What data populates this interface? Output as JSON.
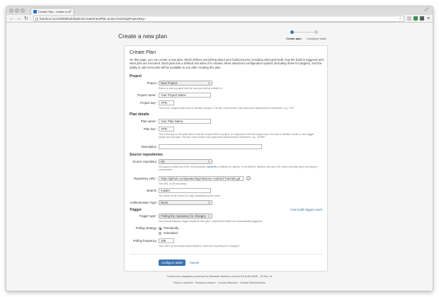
{
  "browser": {
    "tab_title": "Create Plan - Create a ne",
    "url": "bamboo.local:8085/build/admin/create/newPlan.action?existingProjectKey="
  },
  "header": {
    "title": "Create a new plan"
  },
  "wizard": {
    "steps": [
      "Create plan",
      "Configure tasks"
    ]
  },
  "form": {
    "heading": "Create Plan",
    "intro": "On this page, you can create a new plan, which defines everything about your build process, including what gets built, how the build is triggered and what jobs are executed. Each plan has a Default Job when it is created. More advanced configuration options (including those for plugins), and the ability to add more jobs will be available to you after creating this plan.",
    "project_section": "Project",
    "project_label": "Project",
    "project_value": "New Project",
    "project_help": "Select or add a project that the new plan will be created in",
    "project_name_label": "Project name",
    "project_name_value": "Your Project Name",
    "project_key_label": "Project key",
    "project_key_value": "YPN",
    "project_key_help": "This is the unique project key to identify a project. The key must contain only uppercase alphanumeric characters. e.g. \"FIX\".",
    "plan_section": "Plan details",
    "plan_name_label": "Plan name",
    "plan_name_value": "Your Plan Name",
    "plan_key_label": "Plan key",
    "plan_key_value": "YPN",
    "plan_key_help": "This is the key for the plan which must be unique within a project. In conjunction with the project key, it is used to identify a build in urls, trigger scripts and api calls. The key must contain only uppercase alphanumeric characters. e.g. \"CORE\".",
    "description_label": "Description",
    "source_section": "Source repositories",
    "source_repo_label": "Source repository",
    "source_repo_value": "Git",
    "source_repo_help_a": "Git support works best if the Git executable",
    "source_repo_help_link": "capability",
    "source_repo_help_b": "is defined for agents. If not defined, Bamboo will use JGit, which currently does not support submodules.",
    "repo_url_label": "Repository URL",
    "repo_url_value": "https://github.com/javatechig/Advance-Android-Tutorials.git",
    "repo_url_help": "The URL of Git repository",
    "branch_label": "Branch",
    "branch_value": "master",
    "branch_help": "The name of the branch (or tag) containing source code.",
    "auth_label": "Authentication Type",
    "auth_value": "None",
    "trigger_section": "Trigger",
    "trigger_link": "How build triggers work",
    "trigger_type_label": "Trigger type",
    "trigger_type_value": "Polling the repository for changes",
    "trigger_type_help": "How should Bamboo trigger builds for this plan? (dependent builds are automatically triggered)",
    "polling_strategy_label": "Polling strategy",
    "polling_periodically": "Periodically",
    "polling_scheduled": "Scheduled",
    "polling_frequency_label": "Polling frequency",
    "polling_frequency_value": "180",
    "polling_frequency_help": "How often (in seconds) should Bamboo check the repository for changes?",
    "configure_button": "Configure tasks",
    "cancel_link": "Cancel"
  },
  "footer": {
    "line1": "Continuous integration powered by Atlassian Bamboo version 5.6 build 5608 - 10 Nov 14",
    "links": "Report a problem  ·  Request a feature  ·  Contact Atlassian  ·  Contact Administrators"
  },
  "colors": {
    "accent": "#3b73af",
    "link": "#3572b0",
    "required": "#d04437"
  }
}
